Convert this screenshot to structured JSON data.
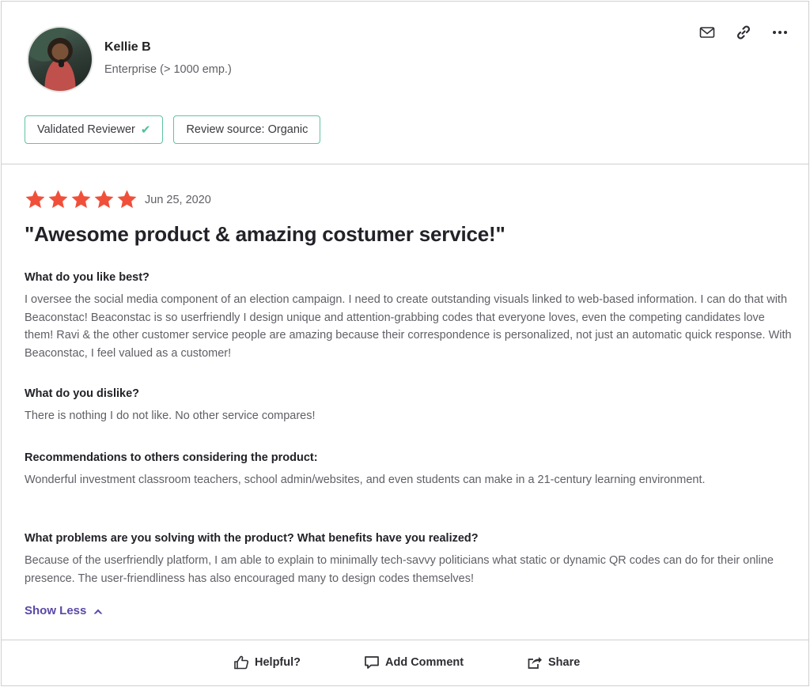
{
  "reviewer": {
    "name": "Kellie B",
    "company": "Enterprise (> 1000 emp.)"
  },
  "header_actions": {
    "icons": [
      "mail-icon",
      "link-icon",
      "more-icon"
    ]
  },
  "badges": {
    "validated": "Validated Reviewer",
    "source": "Review source: Organic"
  },
  "review": {
    "rating": 5,
    "rating_max": 5,
    "date": "Jun 25, 2020",
    "title": "\"Awesome product & amazing costumer service!\"",
    "qa": [
      {
        "question": "What do you like best?",
        "answer": "I oversee the social media component of an election campaign. I need to create outstanding visuals linked to web-based information. I can do that with Beaconstac! Beaconstac is so userfriendly I design unique and attention-grabbing codes that everyone loves, even the competing candidates love them! Ravi & the other customer service people are amazing because their correspondence is personalized, not just an automatic quick response. With Beaconstac, I feel valued as a customer!"
      },
      {
        "question": "What do you dislike?",
        "answer": "There is nothing I do not like. No other service compares!"
      },
      {
        "question": "Recommendations to others considering the product:",
        "answer": "Wonderful investment classroom teachers, school admin/websites, and even students can make in a 21-century learning environment."
      },
      {
        "question": "What problems are you solving with the product? What benefits have you realized?",
        "answer": "Because of the userfriendly platform, I am able to explain to minimally tech-savvy politicians what static or dynamic QR codes can do for their online presence. The user-friendliness has also encouraged many to design codes themselves!"
      }
    ],
    "show_less": "Show Less"
  },
  "footer": {
    "helpful": "Helpful?",
    "add_comment": "Add Comment",
    "share": "Share"
  },
  "colors": {
    "star": "#f0503a",
    "badge_border": "#5fc3a4",
    "link": "#5a48a8"
  }
}
